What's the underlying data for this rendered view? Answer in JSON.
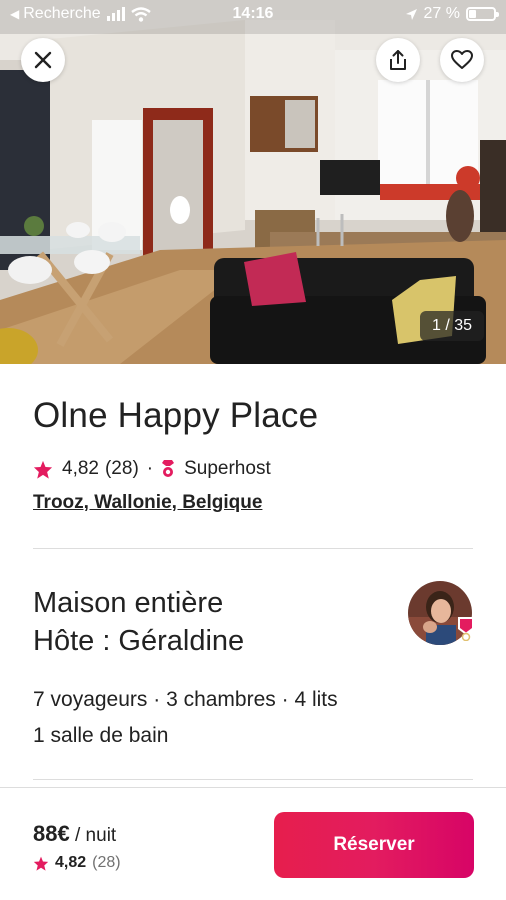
{
  "status_bar": {
    "back_app": "Recherche",
    "time": "14:16",
    "battery": "27 %",
    "battery_level": 0.27
  },
  "hero": {
    "photo_counter": "1 / 35"
  },
  "listing": {
    "title": "Olne Happy Place",
    "rating": "4,82",
    "reviews": "(28)",
    "separator": "·",
    "superhost_label": "Superhost",
    "location": "Trooz, Wallonie, Belgique"
  },
  "host": {
    "line1": "Maison entière",
    "line2": "Hôte : Géraldine"
  },
  "facts": {
    "line1": "7 voyageurs · 3 chambres · 4 lits",
    "line2": "1 salle de bain"
  },
  "footer": {
    "price": "88€",
    "per_night": "/ nuit",
    "rating": "4,82",
    "reviews": "(28)",
    "reserve_label": "Réserver"
  },
  "colors": {
    "brand": "#E31C5F",
    "text": "#222222",
    "muted": "#717171"
  },
  "icons": [
    "back-arrow-icon",
    "signal-icon",
    "wifi-icon",
    "location-arrow-icon",
    "battery-icon",
    "close-icon",
    "share-icon",
    "heart-icon",
    "star-icon",
    "superhost-badge-icon"
  ]
}
